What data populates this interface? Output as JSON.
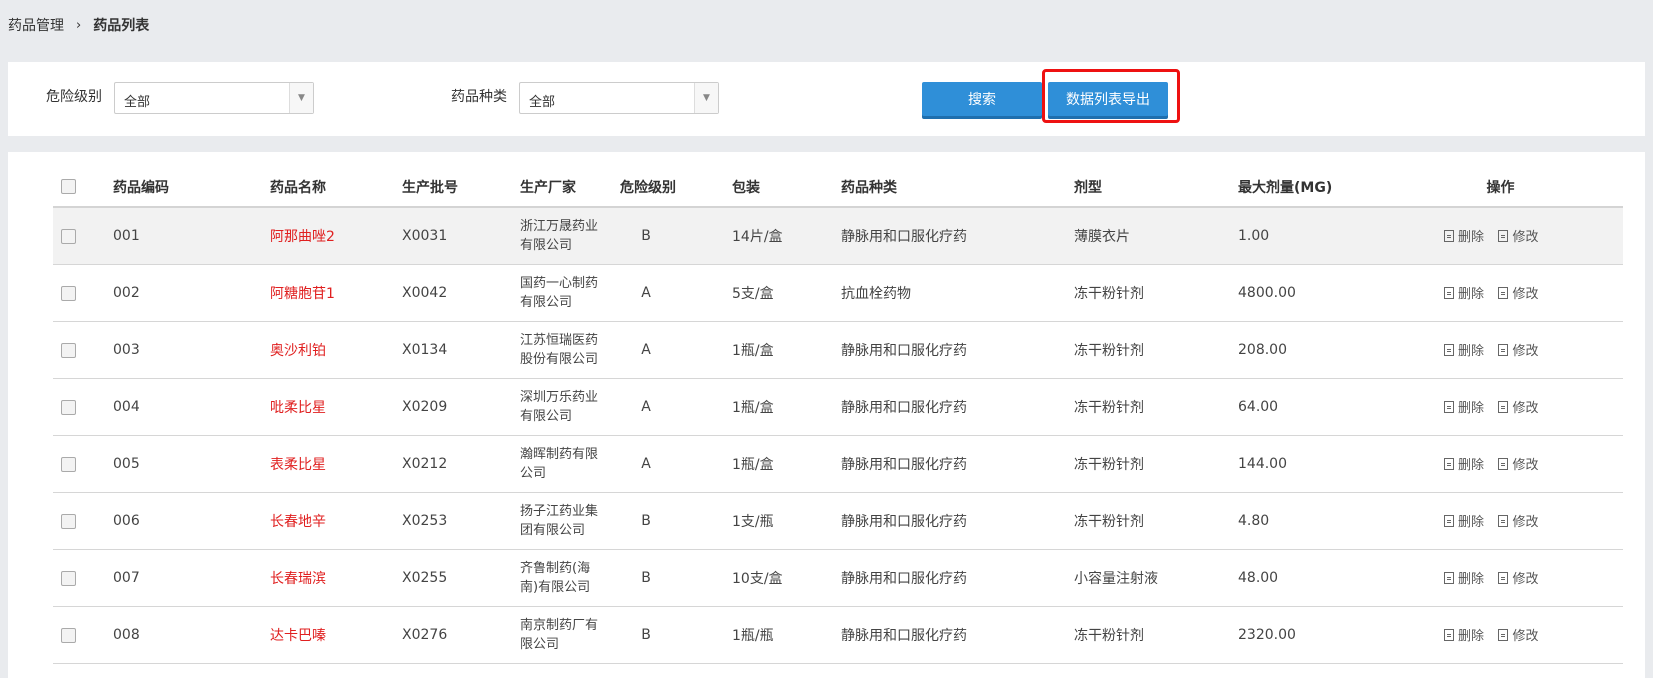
{
  "breadcrumb": {
    "parent": "药品管理",
    "separator": "›",
    "current": "药品列表"
  },
  "filters": {
    "danger_label": "危险级别",
    "danger_value": "全部",
    "category_label": "药品种类",
    "category_value": "全部",
    "search_label": "搜索",
    "export_label": "数据列表导出"
  },
  "table": {
    "headers": {
      "code": "药品编码",
      "name": "药品名称",
      "batch": "生产批号",
      "maker": "生产厂家",
      "danger": "危险级别",
      "pack": "包装",
      "category": "药品种类",
      "form": "剂型",
      "maxdose": "最大剂量(MG)",
      "ops": "操作"
    },
    "delete_label": "删除",
    "edit_label": "修改",
    "rows": [
      {
        "code": "001",
        "name": "阿那曲唑2",
        "batch": "X0031",
        "maker1": "浙江万晟药业",
        "maker2": "有限公司",
        "danger": "B",
        "pack": "14片/盒",
        "category": "静脉用和口服化疗药",
        "form": "薄膜衣片",
        "maxdose": "1.00"
      },
      {
        "code": "002",
        "name": "阿糖胞苷1",
        "batch": "X0042",
        "maker1": "国药一心制药",
        "maker2": "有限公司",
        "danger": "A",
        "pack": "5支/盒",
        "category": "抗血栓药物",
        "form": "冻干粉针剂",
        "maxdose": "4800.00"
      },
      {
        "code": "003",
        "name": "奥沙利铂",
        "batch": "X0134",
        "maker1": "江苏恒瑞医药",
        "maker2": "股份有限公司",
        "danger": "A",
        "pack": "1瓶/盒",
        "category": "静脉用和口服化疗药",
        "form": "冻干粉针剂",
        "maxdose": "208.00"
      },
      {
        "code": "004",
        "name": "吡柔比星",
        "batch": "X0209",
        "maker1": "深圳万乐药业",
        "maker2": "有限公司",
        "danger": "A",
        "pack": "1瓶/盒",
        "category": "静脉用和口服化疗药",
        "form": "冻干粉针剂",
        "maxdose": "64.00"
      },
      {
        "code": "005",
        "name": "表柔比星",
        "batch": "X0212",
        "maker1": "瀚晖制药有限",
        "maker2": "公司",
        "danger": "A",
        "pack": "1瓶/盒",
        "category": "静脉用和口服化疗药",
        "form": "冻干粉针剂",
        "maxdose": "144.00"
      },
      {
        "code": "006",
        "name": "长春地辛",
        "batch": "X0253",
        "maker1": "扬子江药业集",
        "maker2": "团有限公司",
        "danger": "B",
        "pack": "1支/瓶",
        "category": "静脉用和口服化疗药",
        "form": "冻干粉针剂",
        "maxdose": "4.80"
      },
      {
        "code": "007",
        "name": "长春瑞滨",
        "batch": "X0255",
        "maker1": "齐鲁制药(海",
        "maker2": "南)有限公司",
        "danger": "B",
        "pack": "10支/盒",
        "category": "静脉用和口服化疗药",
        "form": "小容量注射液",
        "maxdose": "48.00"
      },
      {
        "code": "008",
        "name": "达卡巴嗪",
        "batch": "X0276",
        "maker1": "南京制药厂有",
        "maker2": "限公司",
        "danger": "B",
        "pack": "1瓶/瓶",
        "category": "静脉用和口服化疗药",
        "form": "冻干粉针剂",
        "maxdose": "2320.00"
      }
    ]
  }
}
